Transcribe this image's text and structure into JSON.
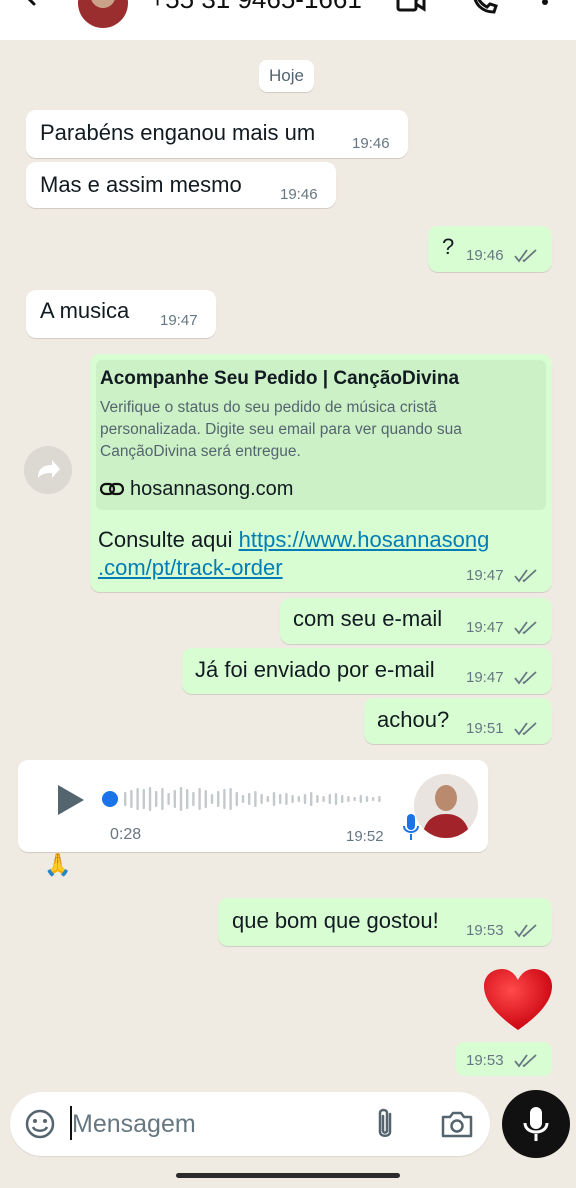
{
  "header": {
    "contact_number": "+55 31 9465-1661"
  },
  "date_divider": "Hoje",
  "messages": [
    {
      "direction": "in",
      "text": "Parabéns enganou mais um",
      "time": "19:46"
    },
    {
      "direction": "in",
      "text": "Mas e assim mesmo",
      "time": "19:46"
    },
    {
      "direction": "out",
      "text": "?",
      "time": "19:46",
      "read": true
    },
    {
      "direction": "in",
      "text": "A musica",
      "time": "19:47"
    },
    {
      "direction": "out",
      "type": "link",
      "preview_title": "Acompanhe Seu Pedido | CançãoDivina",
      "preview_description": "Verifique o status do seu pedido de música cristã personalizada. Digite seu email para ver quando sua CançãoDivina será entregue.",
      "preview_domain": "hosannasong.com",
      "text_prefix": "Consulte aqui ",
      "url_line1": "https://www.hosannasong",
      "url_line2": ".com/pt/track-order",
      "time": "19:47",
      "read": true
    },
    {
      "direction": "out",
      "text": "com seu e-mail",
      "time": "19:47",
      "read": true
    },
    {
      "direction": "out",
      "text": "Já foi enviado por e-mail",
      "time": "19:47",
      "read": true
    },
    {
      "direction": "out",
      "text": "achou?",
      "time": "19:51",
      "read": true
    },
    {
      "direction": "in",
      "type": "voice",
      "duration": "0:28",
      "time": "19:52",
      "reaction": "🙏"
    },
    {
      "direction": "out",
      "text": "que bom que gostou!",
      "time": "19:53",
      "read": true
    },
    {
      "direction": "out",
      "type": "emoji",
      "emoji": "heart",
      "time": "19:53",
      "read": true
    }
  ],
  "composer": {
    "placeholder": "Mensagem"
  },
  "colors": {
    "background": "#efeae2",
    "incoming_bubble": "#ffffff",
    "outgoing_bubble": "#d9fdd3",
    "read_ticks": "#667781",
    "link": "#027eb5",
    "mic_button": "#111111"
  },
  "icons": [
    "back-arrow-icon",
    "video-call-icon",
    "phone-icon",
    "more-icon",
    "forward-icon",
    "link-icon",
    "play-icon",
    "mic-icon",
    "emoji-icon",
    "attach-icon",
    "camera-icon"
  ]
}
